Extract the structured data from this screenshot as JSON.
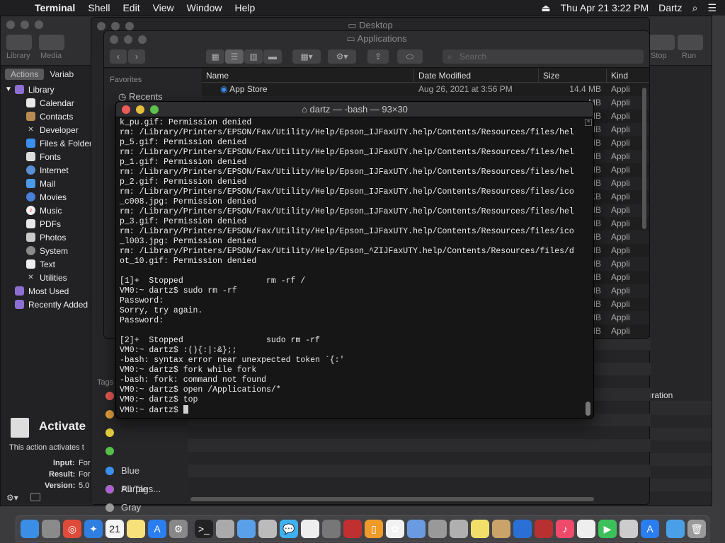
{
  "menubar": {
    "app": "Terminal",
    "items": [
      "Shell",
      "Edit",
      "View",
      "Window",
      "Help"
    ],
    "datetime": "Thu Apr 21  3:22 PM",
    "user": "Dartz"
  },
  "automator": {
    "toolbar_labels": [
      "Library",
      "Media",
      "Stop",
      "Run"
    ],
    "segment": [
      "Actions",
      "Variab"
    ],
    "library": {
      "root": "Library",
      "items": [
        "Calendar",
        "Contacts",
        "Developer",
        "Files & Folders",
        "Fonts",
        "Internet",
        "Mail",
        "Movies",
        "Music",
        "PDFs",
        "Photos",
        "System",
        "Text",
        "Utilities"
      ],
      "extra": [
        "Most Used",
        "Recently Added"
      ]
    },
    "action_title": "Activate",
    "action_desc": "This action activates t",
    "input_label": "Input:",
    "input_value": "For",
    "result_label": "Result:",
    "result_value": "For",
    "version_label": "Version:",
    "version_value": "5.0",
    "duration_header": "Duration"
  },
  "finder_desktop": {
    "title": "Desktop",
    "tags_label": "Tags",
    "tags": [
      {
        "name": "",
        "color": "#ec5b57"
      },
      {
        "name": "",
        "color": "#e8a13b"
      },
      {
        "name": "",
        "color": "#e4cd3e"
      },
      {
        "name": "",
        "color": "#56c04a"
      },
      {
        "name": "Blue",
        "color": "#3b8ff0"
      },
      {
        "name": "Purple",
        "color": "#b659e0"
      },
      {
        "name": "Gray",
        "color": "#9a9a9a"
      },
      {
        "name": "All Tags...",
        "color": "none"
      }
    ]
  },
  "finder_apps": {
    "title": "Applications",
    "search_placeholder": "Search",
    "sidebar_header": "Favorites",
    "sidebar_items": [
      "Recents"
    ],
    "columns": [
      "Name",
      "Date Modified",
      "Size",
      "Kind"
    ],
    "rows": [
      {
        "name": "App Store",
        "date": "Aug 26, 2021 at 3:56 PM",
        "size": "14.4 MB",
        "kind": "Appli"
      }
    ],
    "partial_sizes": [
      "MB",
      "MB",
      "MB",
      "MB",
      "MB",
      "MB",
      "MB",
      "KB",
      "MB",
      "MB",
      "MB",
      "MB",
      "MB",
      "MB",
      "MB",
      "MB",
      "MB",
      "MB"
    ],
    "partial_kind": "Appli"
  },
  "terminal": {
    "title": "dartz — -bash — 93×30",
    "lines": [
      "k_pu.gif: Permission denied",
      "rm: /Library/Printers/EPSON/Fax/Utility/Help/Epson_IJFaxUTY.help/Contents/Resources/files/hel",
      "p_5.gif: Permission denied",
      "rm: /Library/Printers/EPSON/Fax/Utility/Help/Epson_IJFaxUTY.help/Contents/Resources/files/hel",
      "p_1.gif: Permission denied",
      "rm: /Library/Printers/EPSON/Fax/Utility/Help/Epson_IJFaxUTY.help/Contents/Resources/files/hel",
      "p_2.gif: Permission denied",
      "rm: /Library/Printers/EPSON/Fax/Utility/Help/Epson_IJFaxUTY.help/Contents/Resources/files/ico",
      "_c008.jpg: Permission denied",
      "rm: /Library/Printers/EPSON/Fax/Utility/Help/Epson_IJFaxUTY.help/Contents/Resources/files/hel",
      "p_3.gif: Permission denied",
      "rm: /Library/Printers/EPSON/Fax/Utility/Help/Epson_IJFaxUTY.help/Contents/Resources/files/ico",
      "_l003.jpg: Permission denied",
      "rm: /Library/Printers/EPSON/Fax/Utility/Help/Epson_^ZIJFaxUTY.help/Contents/Resources/files/d",
      "ot_10.gif: Permission denied",
      "",
      "[1]+  Stopped                 rm -rf /",
      "VM0:~ dartz$ sudo rm -rf",
      "Password:",
      "Sorry, try again.",
      "Password:",
      "",
      "[2]+  Stopped                 sudo rm -rf",
      "VM0:~ dartz$ :(){:|:&};;",
      "-bash: syntax error near unexpected token `{:'",
      "VM0:~ dartz$ fork while fork",
      "-bash: fork: command not found",
      "VM0:~ dartz$ open /Applications/*",
      "VM0:~ dartz$ top"
    ],
    "prompt": "VM0:~ dartz$ "
  },
  "dock": {
    "icons": [
      "finder-icon",
      "launchpad-icon",
      "chrome-icon",
      "safari-icon",
      "calendar-icon",
      "notes-icon",
      "app-store-icon",
      "system-preferences-icon",
      "terminal-icon",
      "disk-utility-icon",
      "preview-icon",
      "script-editor-icon",
      "messages-icon",
      "textedit-icon",
      "automator-icon",
      "photo-booth-icon",
      "books-icon",
      "photos-icon",
      "grapher-icon",
      "directory-utility-icon",
      "keychain-icon",
      "stickies-icon",
      "contacts-icon",
      "safari-tech-icon",
      "dictionary-icon",
      "music-icon",
      "notes2-icon",
      "facetime-icon",
      "font-book-icon",
      "app-store2-icon",
      "downloads-icon",
      "trash-icon"
    ],
    "calendar_day": "21"
  }
}
